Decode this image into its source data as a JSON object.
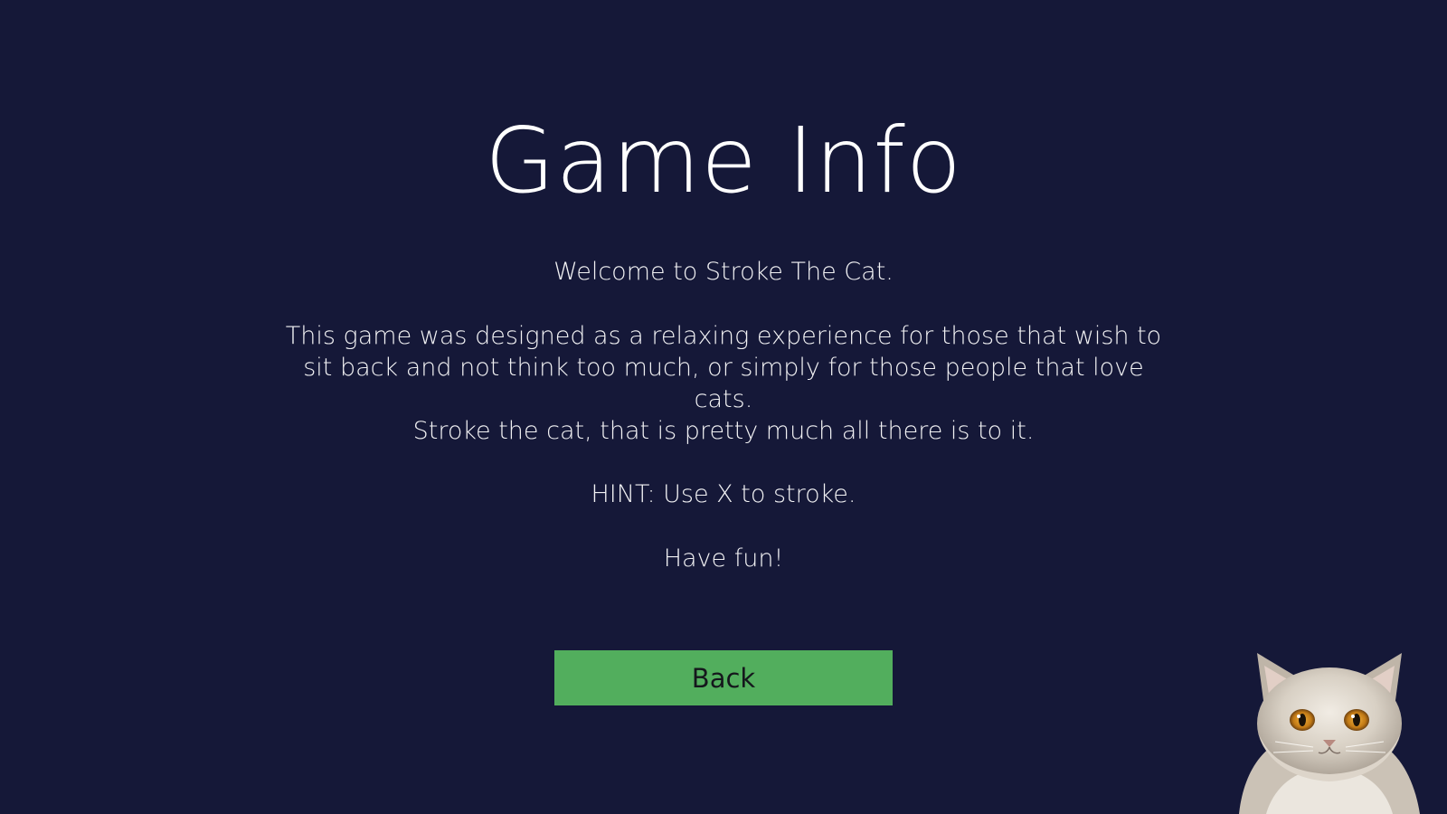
{
  "screen": {
    "title": "Game Info",
    "paragraphs": {
      "welcome": "Welcome to Stroke The Cat.",
      "description": "This game was designed as a relaxing experience for those that wish to sit back and not think too much, or simply for those people that love cats.",
      "stroke": "Stroke the cat, that is pretty much all there is to it.",
      "hint": "HINT: Use X to stroke.",
      "fun": "Have fun!"
    },
    "back_button_label": "Back"
  },
  "decorations": {
    "cat_image": "cat-image"
  },
  "colors": {
    "background": "#151838",
    "button": "#52ae5d",
    "text": "#ffffff"
  }
}
